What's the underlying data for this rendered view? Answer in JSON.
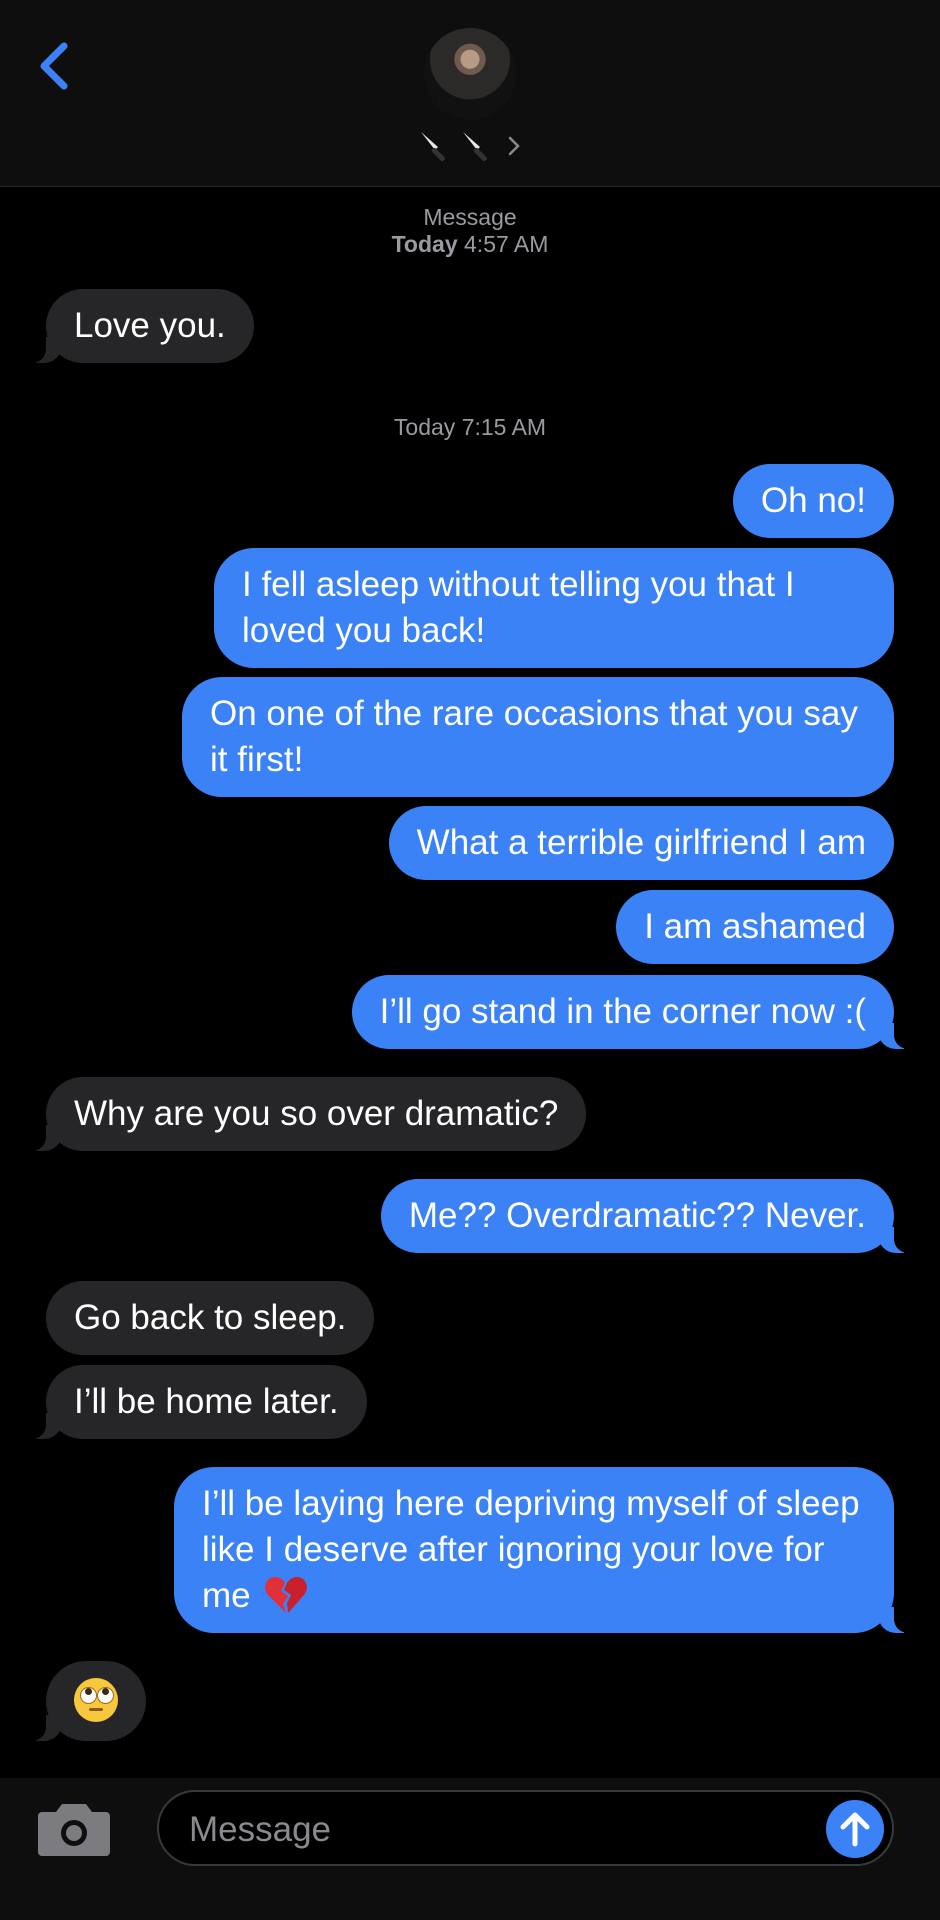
{
  "header": {
    "back_icon": "chevron-left-icon",
    "avatar": "contact-photo",
    "contact_name_icons": [
      "knife-icon",
      "knife-icon",
      "chevron-right-icon"
    ]
  },
  "timestamps": [
    {
      "label": "Message",
      "day": "Today",
      "time": "4:57 AM"
    },
    {
      "label": "",
      "day": "Today",
      "time": "7:15 AM"
    }
  ],
  "messages": [
    {
      "dir": "in",
      "text": "Love you."
    },
    {
      "dir": "out",
      "text": "Oh no!"
    },
    {
      "dir": "out",
      "text": "I fell asleep without telling you that I loved you back!"
    },
    {
      "dir": "out",
      "text": "On one of the rare occasions that you say it first!"
    },
    {
      "dir": "out",
      "text": "What a terrible girlfriend I am"
    },
    {
      "dir": "out",
      "text": "I am ashamed"
    },
    {
      "dir": "out",
      "text": "I’ll go stand in the corner now :("
    },
    {
      "dir": "in",
      "text": "Why are you so over dramatic?"
    },
    {
      "dir": "out",
      "text": "Me?? Overdramatic?? Never."
    },
    {
      "dir": "in",
      "text": "Go back to sleep."
    },
    {
      "dir": "in",
      "text": "I’ll be home later."
    },
    {
      "dir": "out",
      "text": "I’ll be laying here depriving myself of sleep like I deserve after ignoring your love for me",
      "emoji": "broken-heart-icon"
    },
    {
      "dir": "in",
      "text": "",
      "emoji": "eye-roll-face-icon"
    }
  ],
  "composer": {
    "placeholder": "Message",
    "camera_icon": "camera-icon",
    "send_icon": "arrow-up-icon"
  },
  "colors": {
    "accent": "#3B82F6",
    "incoming_bubble": "#262629",
    "background": "#000000",
    "header_bg": "#0E0E0E"
  }
}
